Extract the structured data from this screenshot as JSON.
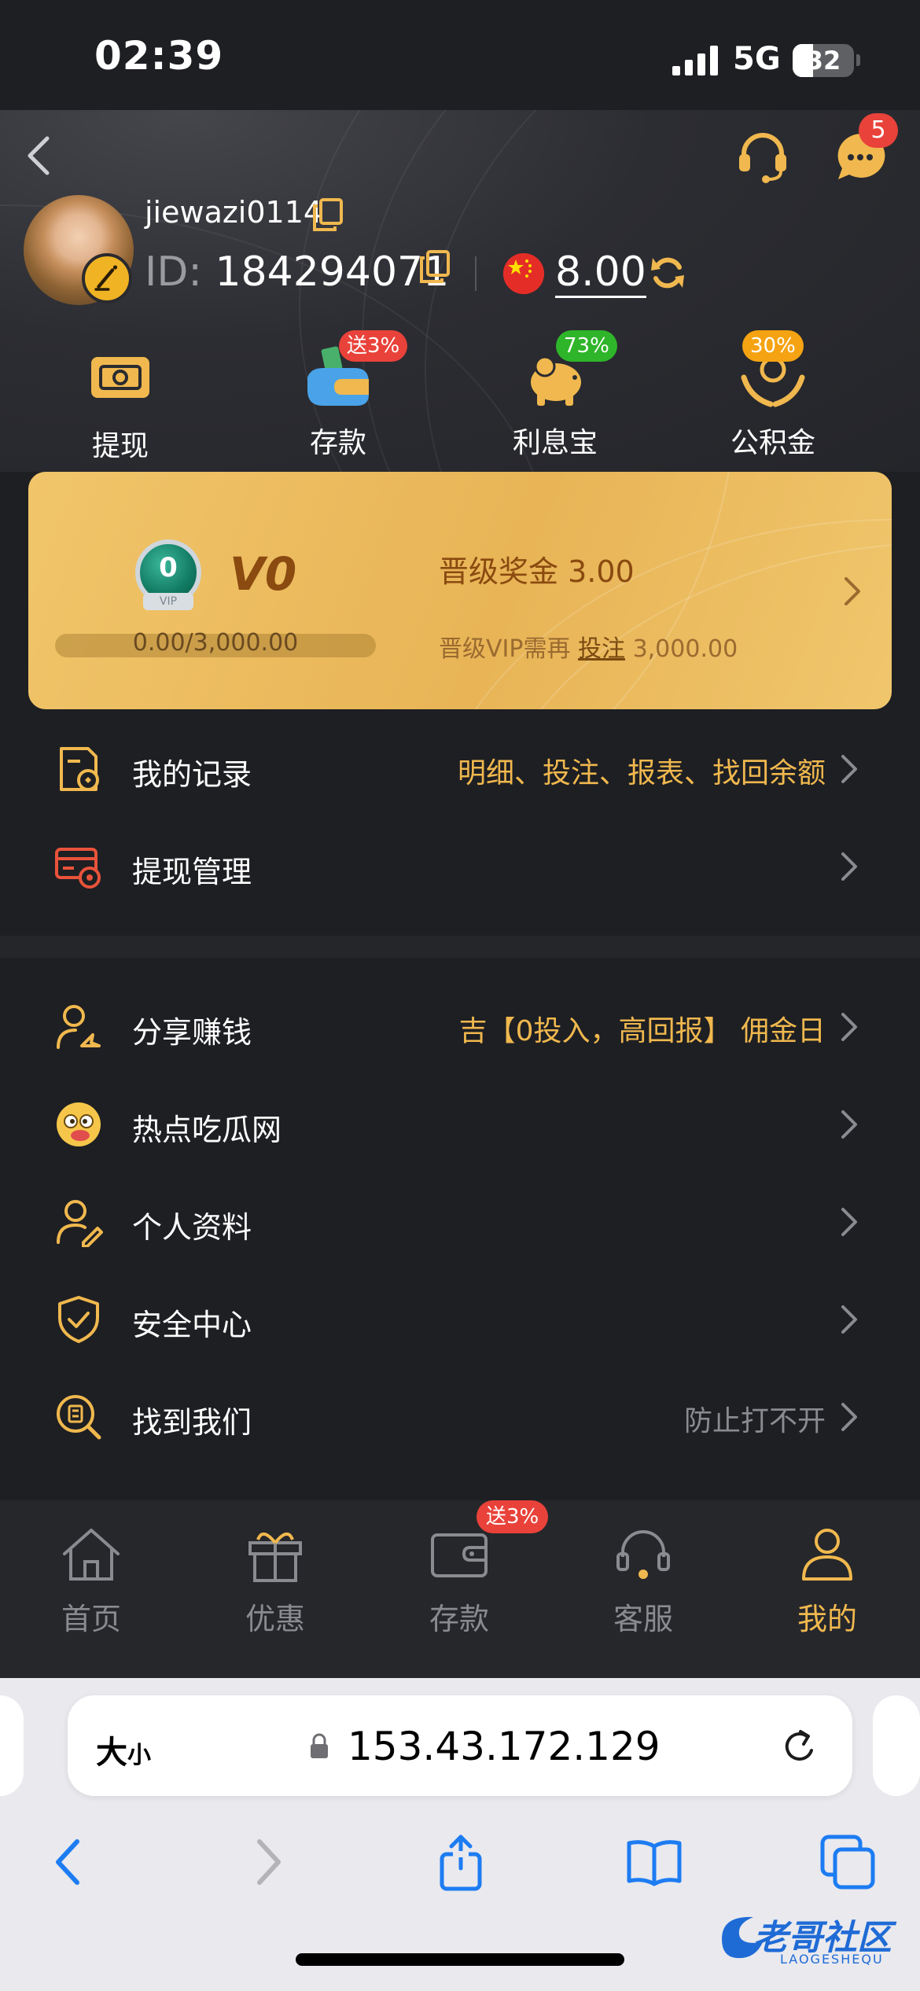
{
  "status_bar": {
    "time": "02:39",
    "network": "5G",
    "battery": "32"
  },
  "header": {
    "message_count": "5"
  },
  "user": {
    "username": "jiewazi0114",
    "id_label": "ID:",
    "id_value": "184294071",
    "balance": "8.00"
  },
  "quick_actions": [
    {
      "label": "提现",
      "icon": "withdraw-icon"
    },
    {
      "label": "存款",
      "icon": "deposit-wallet-icon",
      "badge": "送3%",
      "badge_color": "#e9423a"
    },
    {
      "label": "利息宝",
      "icon": "piggy-bank-icon",
      "badge": "73%",
      "badge_color": "#2fb52a"
    },
    {
      "label": "公积金",
      "icon": "hands-coin-icon",
      "badge": "30%",
      "badge_color": "#f5a312"
    }
  ],
  "vip": {
    "medal_number": "0",
    "medal_text": "VIP",
    "level": "V0",
    "progress_text": "0.00/3,000.00",
    "progress_fraction": 0.0,
    "bonus_label": "晋级奖金",
    "bonus_value": "3.00",
    "need_prefix": "晋级VIP需再",
    "need_link": "投注",
    "need_amount": "3,000.00"
  },
  "menu_group1": [
    {
      "label": "我的记录",
      "value": "明细、投注、报表、找回余额",
      "icon": "records-icon"
    },
    {
      "label": "提现管理",
      "value": "",
      "icon": "card-settings-icon"
    }
  ],
  "menu_group2": [
    {
      "label": "分享赚钱",
      "value": "吉【0投入，高回报】 佣金日",
      "icon": "share-user-icon"
    },
    {
      "label": "热点吃瓜网",
      "value": "",
      "icon": "emoji-icon"
    },
    {
      "label": "个人资料",
      "value": "",
      "icon": "profile-edit-icon"
    },
    {
      "label": "安全中心",
      "value": "",
      "icon": "shield-icon"
    },
    {
      "label": "找到我们",
      "value": "防止打不开",
      "icon": "find-us-icon"
    }
  ],
  "tabbar": [
    {
      "label": "首页",
      "icon": "home-icon",
      "active": false
    },
    {
      "label": "优惠",
      "icon": "gift-icon",
      "active": false
    },
    {
      "label": "存款",
      "icon": "wallet-icon",
      "active": false,
      "badge": "送3%"
    },
    {
      "label": "客服",
      "icon": "headset-icon",
      "active": false
    },
    {
      "label": "我的",
      "icon": "person-icon",
      "active": true
    }
  ],
  "browser": {
    "text_size_big": "大",
    "text_size_small": "小",
    "url": "153.43.172.129"
  },
  "watermark": {
    "text": "老哥社区",
    "sub": "LAOGESHEQU"
  },
  "colors": {
    "accent": "#f0b84e",
    "badge_red": "#e9423a",
    "vip_gold": "#e8b456"
  }
}
